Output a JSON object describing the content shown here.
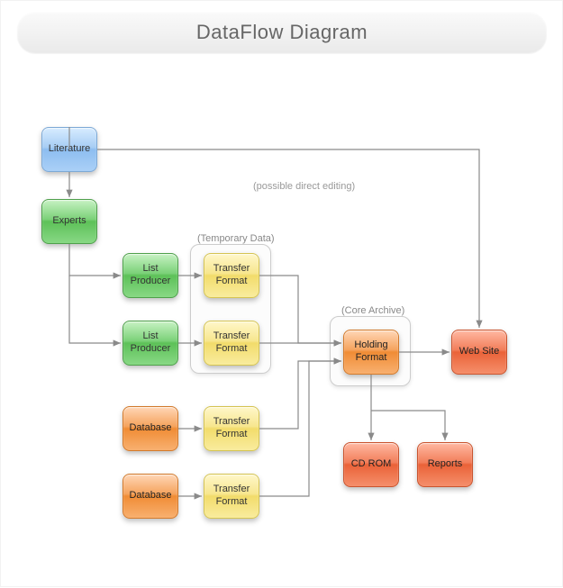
{
  "title": "DataFlow Diagram",
  "annotations": {
    "direct_editing": "(possible direct editing)"
  },
  "groups": {
    "temporary_data": {
      "label": "(Temporary Data)"
    },
    "core_archive": {
      "label": "(Core Archive)"
    }
  },
  "nodes": {
    "literature": {
      "label": "Literature",
      "color": "blue"
    },
    "experts": {
      "label": "Experts",
      "color": "green"
    },
    "list_producer_1": {
      "label": "List Producer",
      "color": "green"
    },
    "list_producer_2": {
      "label": "List Producer",
      "color": "green"
    },
    "transfer_format_1": {
      "label": "Transfer Format",
      "color": "yellow"
    },
    "transfer_format_2": {
      "label": "Transfer Format",
      "color": "yellow"
    },
    "transfer_format_3": {
      "label": "Transfer Format",
      "color": "yellow"
    },
    "transfer_format_4": {
      "label": "Transfer Format",
      "color": "yellow"
    },
    "database_1": {
      "label": "Database",
      "color": "orange"
    },
    "database_2": {
      "label": "Database",
      "color": "orange"
    },
    "holding_format": {
      "label": "Holding Format",
      "color": "orange"
    },
    "cdrom": {
      "label": "CD ROM",
      "color": "red"
    },
    "reports": {
      "label": "Reports",
      "color": "red"
    },
    "website": {
      "label": "Web Site",
      "color": "red"
    }
  },
  "edges": [
    {
      "from": "literature",
      "to": "experts"
    },
    {
      "from": "experts",
      "to": "list_producer_1"
    },
    {
      "from": "experts",
      "to": "list_producer_2"
    },
    {
      "from": "list_producer_1",
      "to": "transfer_format_1"
    },
    {
      "from": "list_producer_2",
      "to": "transfer_format_2"
    },
    {
      "from": "database_1",
      "to": "transfer_format_3"
    },
    {
      "from": "database_2",
      "to": "transfer_format_4"
    },
    {
      "from": "transfer_format_1",
      "to": "holding_format"
    },
    {
      "from": "transfer_format_2",
      "to": "holding_format"
    },
    {
      "from": "transfer_format_3",
      "to": "holding_format"
    },
    {
      "from": "transfer_format_4",
      "to": "holding_format"
    },
    {
      "from": "holding_format",
      "to": "website"
    },
    {
      "from": "holding_format",
      "to": "cdrom"
    },
    {
      "from": "holding_format",
      "to": "reports"
    },
    {
      "from": "experts",
      "to": "website",
      "note": "possible direct editing"
    }
  ]
}
